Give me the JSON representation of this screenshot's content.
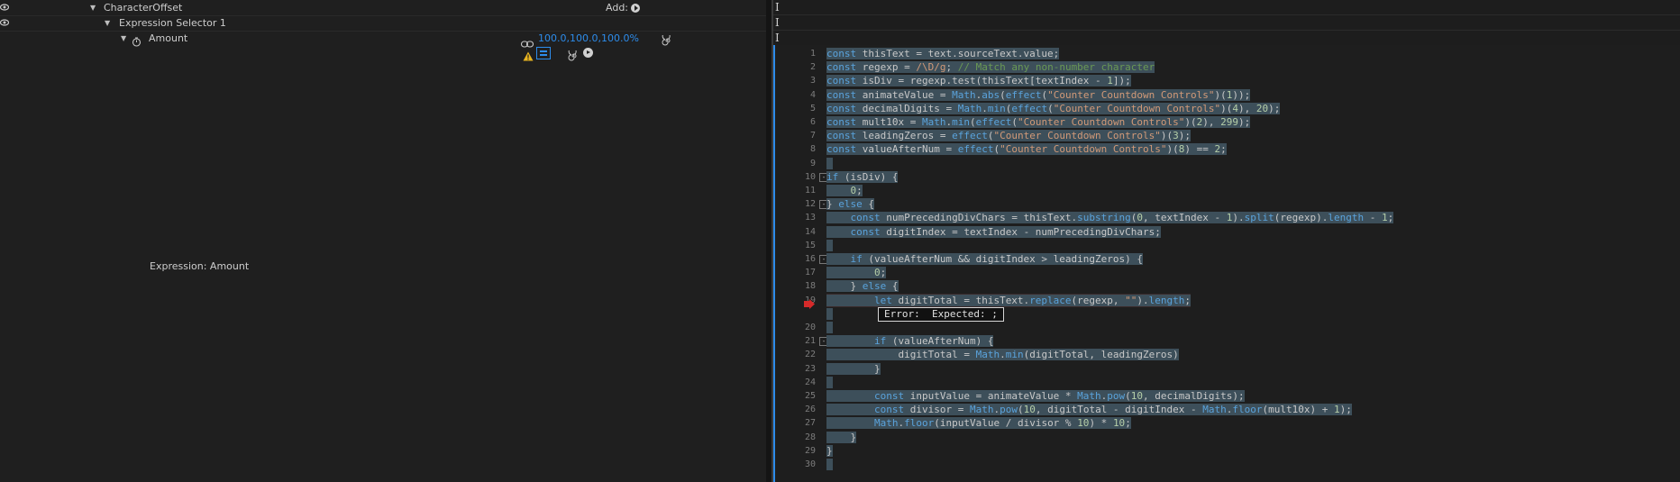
{
  "timeline": {
    "rows": [
      {
        "label": "CharacterOffset",
        "add_label": "Add:"
      },
      {
        "label": "Expression Selector 1"
      },
      {
        "label": "Amount",
        "value": "100.0,100.0,100.0%"
      }
    ],
    "expression_label": "Expression: Amount"
  },
  "editor": {
    "line_numbers": [
      "1",
      "2",
      "3",
      "4",
      "5",
      "6",
      "7",
      "8",
      "9",
      "10",
      "11",
      "12",
      "13",
      "14",
      "15",
      "16",
      "17",
      "18",
      "19",
      "",
      "20",
      "21",
      "22",
      "23",
      "24",
      "25",
      "26",
      "27",
      "28",
      "29",
      "30"
    ],
    "lines": [
      "const thisText = text.sourceText.value;",
      "const regexp = /\\D/g; // Match any non-number character",
      "const isDiv = regexp.test(thisText[textIndex - 1]);",
      "const animateValue = Math.abs(effect(\"Counter Countdown Controls\")(1));",
      "const decimalDigits = Math.min(effect(\"Counter Countdown Controls\")(4), 20);",
      "const mult10x = Math.min(effect(\"Counter Countdown Controls\")(2), 299);",
      "const leadingZeros = effect(\"Counter Countdown Controls\")(3);",
      "const valueAfterNum = effect(\"Counter Countdown Controls\")(8) == 2;",
      "",
      "if (isDiv) {",
      "    0;",
      "} else {",
      "    const numPrecedingDivChars = thisText.substring(0, textIndex - 1).split(regexp).length - 1;",
      "    const digitIndex = textIndex - numPrecedingDivChars;",
      "",
      "    if (valueAfterNum && digitIndex > leadingZeros) {",
      "        0;",
      "    } else {",
      "        let digitTotal = thisText.replace(regexp, \"\").length;",
      "",
      "",
      "        if (valueAfterNum) {",
      "            digitTotal = Math.min(digitTotal, leadingZeros)",
      "        }",
      "",
      "        const inputValue = animateValue * Math.pow(10, decimalDigits);",
      "        const divisor = Math.pow(10, digitTotal - digitIndex - Math.floor(mult10x) + 1);",
      "        Math.floor(inputValue / divisor % 10) * 10;",
      "    }",
      "}",
      ""
    ],
    "error_text": "Error:  Expected: ;"
  }
}
